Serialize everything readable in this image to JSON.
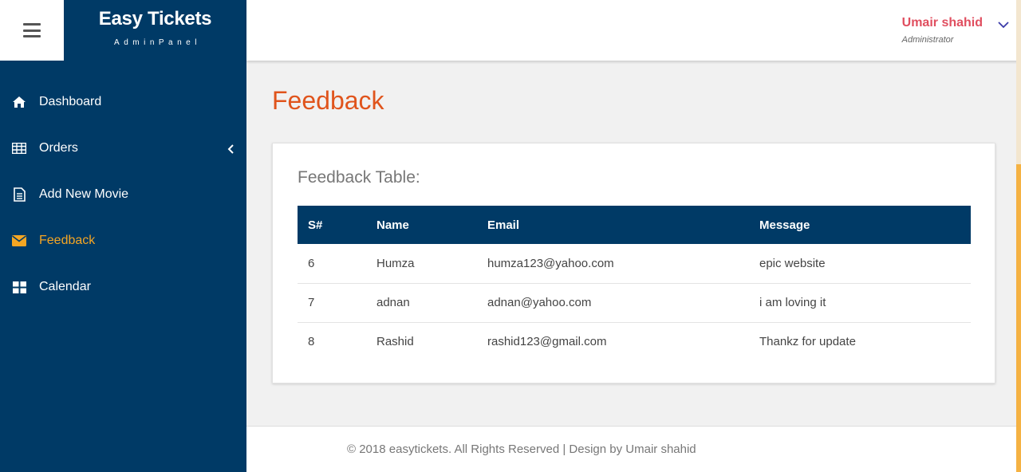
{
  "brand": {
    "title": "Easy Tickets",
    "subtitle": "AdminPanel"
  },
  "user": {
    "name": "Umair shahid",
    "role": "Administrator"
  },
  "sidebar": {
    "items": [
      {
        "label": "Dashboard",
        "icon": "home-icon"
      },
      {
        "label": "Orders",
        "icon": "table-icon"
      },
      {
        "label": "Add New Movie",
        "icon": "file-icon"
      },
      {
        "label": "Feedback",
        "icon": "envelope-icon",
        "active": true
      },
      {
        "label": "Calendar",
        "icon": "grid-icon"
      }
    ]
  },
  "page": {
    "title": "Feedback"
  },
  "feedback": {
    "title": "Feedback Table:",
    "headers": [
      "S#",
      "Name",
      "Email",
      "Message"
    ],
    "rows": [
      [
        "6",
        "Humza",
        "humza123@yahoo.com",
        "epic website"
      ],
      [
        "7",
        "adnan",
        "adnan@yahoo.com",
        "i am loving it"
      ],
      [
        "8",
        "Rashid",
        "rashid123@gmail.com",
        "Thankz for update"
      ]
    ]
  },
  "footer": {
    "text": "© 2018 easytickets. All Rights Reserved | Design by Umair shahid"
  },
  "colors": {
    "sidebar": "#003a66",
    "accent": "#f5a623",
    "title": "#e0541c",
    "user": "#e04e5f"
  }
}
